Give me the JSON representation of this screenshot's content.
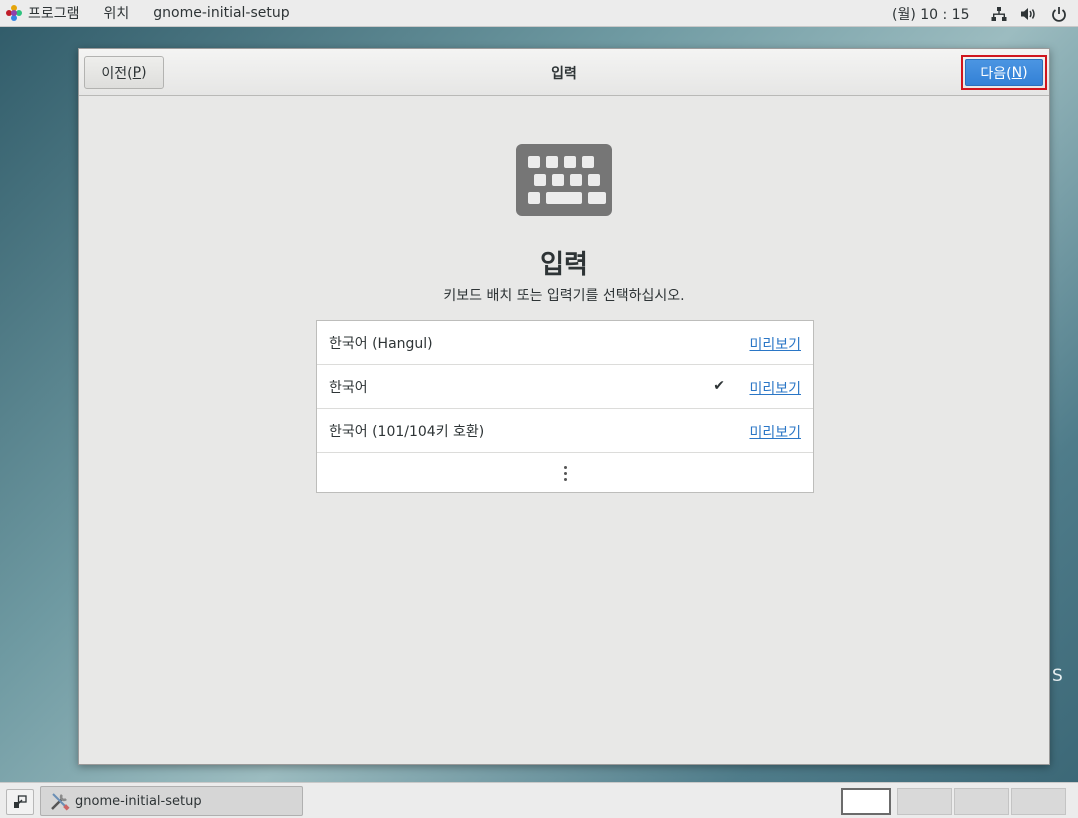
{
  "topbar": {
    "applications_label": "프로그램",
    "places_label": "위치",
    "app_label": "gnome-initial-setup",
    "clock": "(월) 10 : 15"
  },
  "window": {
    "title": "입력",
    "prev_label": "이전(",
    "prev_mnemonic": "P",
    "prev_close": ")",
    "next_label": "다음(",
    "next_mnemonic": "N",
    "next_close": ")"
  },
  "page": {
    "heading": "입력",
    "description": "키보드 배치 또는 입력기를 선택하십시오."
  },
  "inputs": [
    {
      "label": "한국어 (Hangul)",
      "selected": false,
      "preview_label": "미리보기"
    },
    {
      "label": "한국어",
      "selected": true,
      "check": "✔",
      "preview_label": "미리보기"
    },
    {
      "label": "한국어 (101/104키 호환)",
      "selected": false,
      "preview_label": "미리보기"
    }
  ],
  "icons": {
    "page_icon": "keyboard-icon",
    "more": "more-vertical-icon",
    "network": "network-icon",
    "volume": "volume-icon",
    "power": "power-icon"
  },
  "desktop_edge_text": "S",
  "taskbar": {
    "task_label": "gnome-initial-setup",
    "workspaces": 4,
    "active_workspace": 1
  }
}
